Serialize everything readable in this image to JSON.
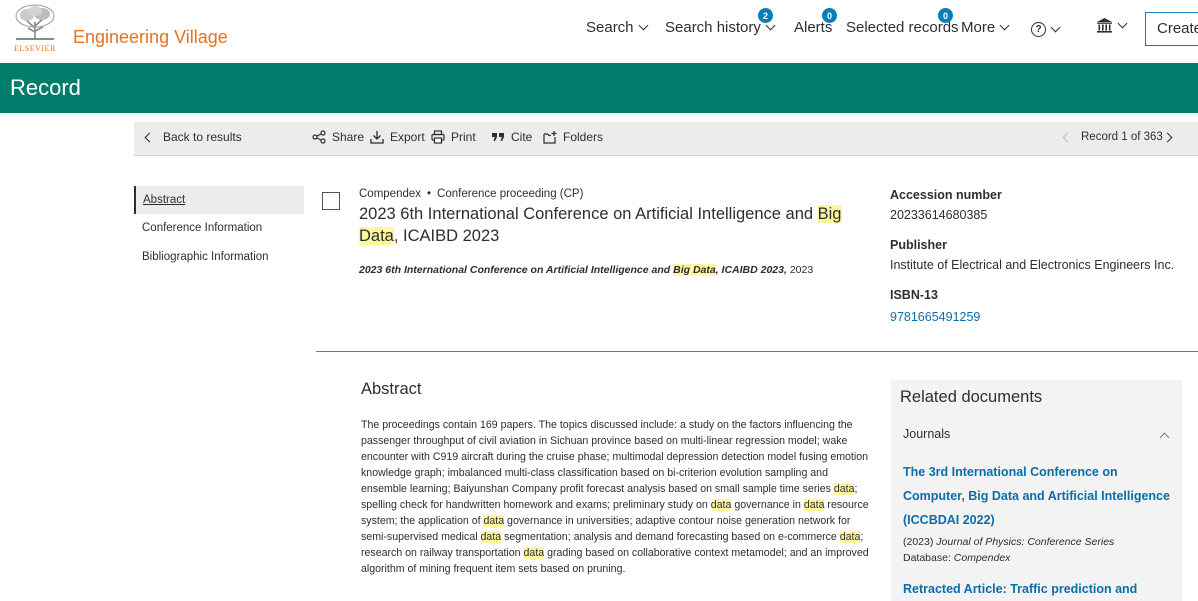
{
  "header": {
    "logo_text": "ELSEVIER",
    "brand": "Engineering Village",
    "nav": [
      {
        "label": "Search"
      },
      {
        "label": "Search history",
        "badge": "2"
      },
      {
        "label": "Alerts",
        "badge": "0"
      },
      {
        "label": "Selected records",
        "badge": "0"
      },
      {
        "label": "More"
      }
    ],
    "help_glyph": "?",
    "create_label": "Create"
  },
  "banner": {
    "title": "Record"
  },
  "toolbar": {
    "back": "Back to results",
    "share": "Share",
    "export": "Export",
    "print": "Print",
    "cite": "Cite",
    "folders": "Folders",
    "record_position": "Record 1 of 363"
  },
  "sidebar": {
    "items": [
      {
        "label": "Abstract",
        "active": true
      },
      {
        "label": "Conference Information"
      },
      {
        "label": "Bibliographic Information"
      }
    ]
  },
  "record": {
    "database": "Compendex",
    "separator": "•",
    "doc_type": "Conference proceeding (CP)",
    "title_part1": "2023 6th International Conference on Artificial Intelligence and ",
    "title_hl1": "Big",
    "title_hl2": "Data",
    "title_part2": ", ICAIBD 2023",
    "source_part1": "2023 6th International Conference on Artificial Intelligence and ",
    "source_hl": "Big Data",
    "source_part2": ", ICAIBD 2023,",
    "source_year": " 2023"
  },
  "info": {
    "accession_label": "Accession number",
    "accession_value": "20233614680385",
    "publisher_label": "Publisher",
    "publisher_value": "Institute of Electrical and Electronics Engineers Inc.",
    "isbn_label": "ISBN-13",
    "isbn_value": "9781665491259"
  },
  "abstract": {
    "heading": "Abstract",
    "seg1": "The proceedings contain 169 papers. The topics discussed include: a study on the factors influencing the passenger throughput of civil aviation in Sichuan province based on multi-linear regression model; wake encounter with C919 aircraft during the cruise phase; multimodal depression detection model fusing emotion knowledge graph; imbalanced multi-class classification based on bi-criterion evolution sampling and ensemble learning; Baiyunshan Company profit forecast analysis based on small sample time series ",
    "seg2": "; spelling check for handwritten homework and exams; preliminary study on ",
    "seg3": " governance in ",
    "seg4": " resource system; the application of ",
    "seg5": " governance in universities; adaptive contour noise generation network for semi-supervised medical ",
    "seg6": " segmentation; analysis and demand forecasting based on e-commerce ",
    "seg7": "; research on railway transportation ",
    "seg8": " grading based on collaborative context metamodel; and an improved algorithm of mining frequent item sets based on pruning.",
    "hl_word": "data"
  },
  "related": {
    "heading": "Related documents",
    "section": "Journals",
    "doc1_title": "The 3rd International Conference on Computer, Big Data and Artificial Intelligence (ICCBDAI 2022)",
    "doc1_year": "(2023)",
    "doc1_source": "Journal of Physics: Conference Series",
    "doc1_db_label": "Database:",
    "doc1_db": "Compendex",
    "doc2_title": "Retracted Article: Traffic prediction and"
  },
  "colors": {
    "brand_orange": "#e9711c",
    "banner_green": "#007c6a",
    "link_blue": "#0c6ea6",
    "highlight": "#fff6a0"
  }
}
